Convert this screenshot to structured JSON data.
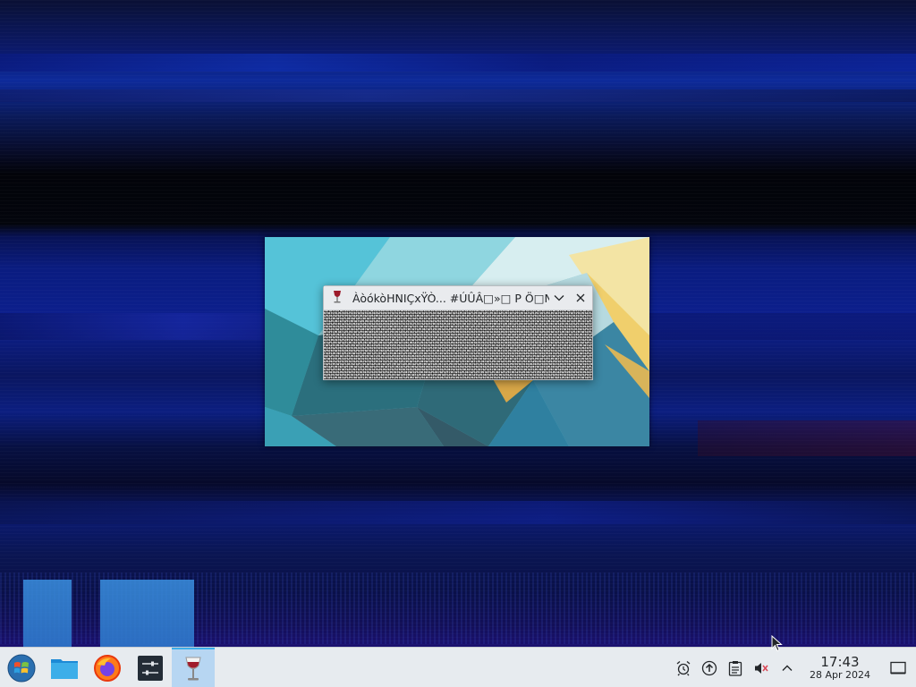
{
  "dialog": {
    "title": "ÀòókòHNIÇxŸÒ... #ÚÛÂ□»□ P Ö□N"
  },
  "taskbar": {
    "items": [
      {
        "name": "application-launcher",
        "icon": "windows-start-orb-icon"
      },
      {
        "name": "file-manager",
        "icon": "folder-icon"
      },
      {
        "name": "firefox",
        "icon": "firefox-icon"
      },
      {
        "name": "system-settings",
        "icon": "settings-sliders-icon"
      },
      {
        "name": "wine-app",
        "icon": "wine-glass-icon",
        "active": true
      }
    ],
    "tray": {
      "icons": [
        "alarm-icon",
        "update-icon",
        "clipboard-icon",
        "speaker-muted-icon",
        "chevron-up-icon"
      ],
      "time": "17:43",
      "date": "28 Apr 2024"
    }
  },
  "colors": {
    "taskbar_bg": "#e7ebef",
    "active_highlight": "#3daee9"
  }
}
